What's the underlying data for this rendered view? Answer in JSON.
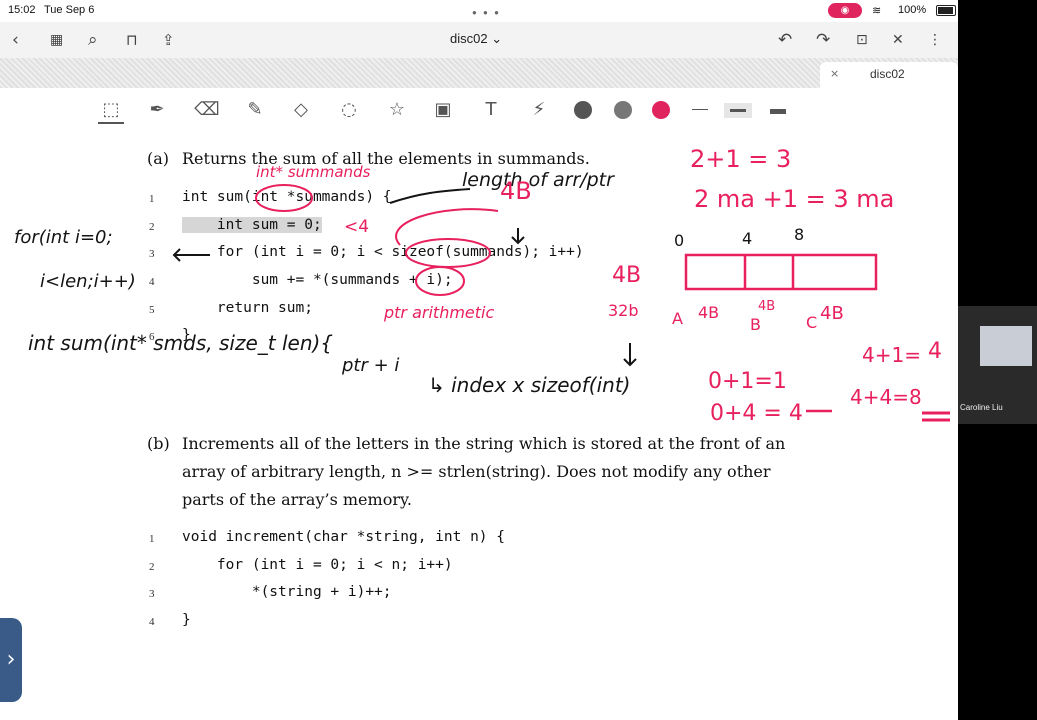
{
  "status": {
    "time": "15:02",
    "date": "Tue Sep 6",
    "battery": "100%",
    "recording": "◉"
  },
  "nav": {
    "title": "disc02 ⌄"
  },
  "tab": {
    "label": "disc02",
    "close": "×"
  },
  "partA": {
    "label": "(a)",
    "text": "Returns the sum of all the elements in summands.",
    "code": [
      {
        "n": "1",
        "text": "int sum(int *summands) {"
      },
      {
        "n": "2",
        "text": "    int sum = 0;"
      },
      {
        "n": "3",
        "text": "    for (int i = 0; i < sizeof(summands); i++)"
      },
      {
        "n": "4",
        "text": "        sum += *(summands + i);"
      },
      {
        "n": "5",
        "text": "    return sum;"
      },
      {
        "n": "6",
        "text": "}"
      }
    ]
  },
  "partB": {
    "label": "(b)",
    "line1": "Increments all of the letters in the string which is stored at the front of an",
    "line2": "array of arbitrary length, n >= strlen(string). Does not modify any other",
    "line3": "parts of the array’s memory.",
    "code": [
      {
        "n": "1",
        "text": "void increment(char *string, int n) {"
      },
      {
        "n": "2",
        "text": "    for (int i = 0; i < n; i++)"
      },
      {
        "n": "3",
        "text": "        *(string + i)++;"
      },
      {
        "n": "4",
        "text": "}"
      }
    ]
  },
  "annotations": {
    "pink": [
      "int* summands",
      "length of arr/ptr",
      "4B",
      "<4",
      "ptr arithmetic",
      "2+1 = 3",
      "2 ma +1 = 3 ma",
      "0",
      "4",
      "8",
      "A",
      "4B",
      "B",
      "4B",
      "C",
      "4B",
      "4+1=",
      "4+4=8",
      "4",
      "4B",
      "32b"
    ],
    "black": [
      "for(int i=0;",
      "i<len;i++)",
      "int sum(int* smds, size_t len){",
      "ptr + i",
      "↳ index x sizeof(int)",
      "0+1=1",
      "0+4 = 4"
    ]
  },
  "pip": {
    "name": "Caroline Liu"
  },
  "colors": {
    "ink_pink": "#e8205e",
    "tool_pink": "#e0245e",
    "tool_gray1": "#555555",
    "tool_gray2": "#777777"
  }
}
